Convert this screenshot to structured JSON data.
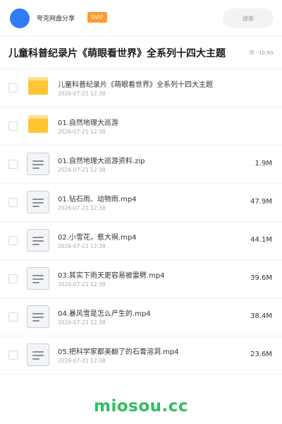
{
  "header": {
    "share_name": "夸克网盘分享",
    "vip_label": "SVIP",
    "search_placeholder": "搜索"
  },
  "folder": {
    "title": "儿童科普纪录片《萌眼看世界》全系列十四大主题",
    "meta": "项 · 10.9G"
  },
  "files": [
    {
      "type": "folder",
      "name": "儿童科普纪录片《萌眼看世界》全系列十四大主题",
      "date": "2026-07-21 12:38",
      "size": ""
    },
    {
      "type": "folder",
      "name": "01.自然地理大巡游",
      "date": "2026-07-21 12:38",
      "size": ""
    },
    {
      "type": "file",
      "name": "01.自然地理大巡游资料.zip",
      "date": "2026-07-21 12:38",
      "size": "1.9M"
    },
    {
      "type": "file",
      "name": "01.钻石雨、动物雨.mp4",
      "date": "2026-07-21 12:38",
      "size": "47.9M"
    },
    {
      "type": "file",
      "name": "02.小雪花，惹大祸.mp4",
      "date": "2026-07-21 12:38",
      "size": "44.1M"
    },
    {
      "type": "file",
      "name": "03.其实下雨天更容易被雷劈.mp4",
      "date": "2026-07-21 12:38",
      "size": "39.6M"
    },
    {
      "type": "file",
      "name": "04.暴风雪是怎么产生的.mp4",
      "date": "2026-07-21 12:38",
      "size": "38.4M"
    },
    {
      "type": "file",
      "name": "05.把科学家都美翻了的石膏溶洞.mp4",
      "date": "2026-07-21 12:38",
      "size": "23.6M"
    }
  ],
  "watermark": "miosou.cc",
  "colors": {
    "avatar": "#2f7cf6",
    "vip_badge": "#ff9c2a",
    "folder_icon": "#ffc533",
    "watermark": "#2ebf5f"
  }
}
